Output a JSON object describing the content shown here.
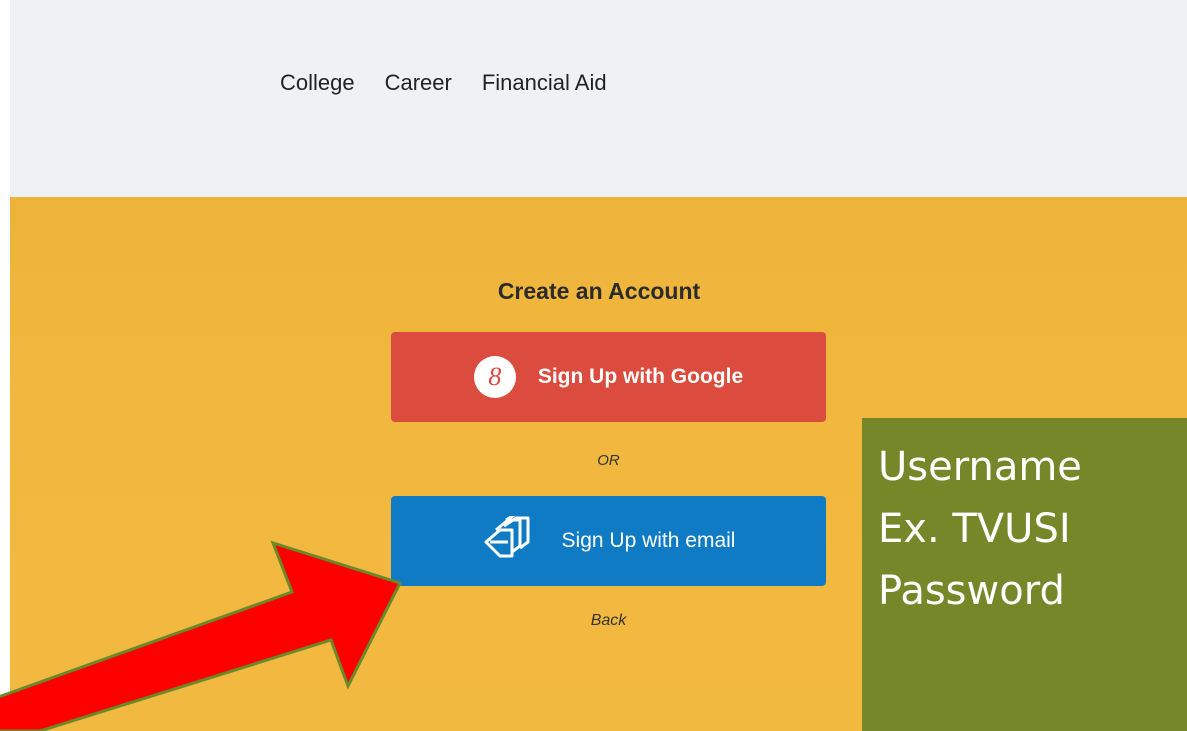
{
  "nav": {
    "items": [
      {
        "label": "College"
      },
      {
        "label": "Career"
      },
      {
        "label": "Financial Aid"
      }
    ]
  },
  "signup": {
    "title": "Create an Account",
    "google_button_label": "Sign Up with Google",
    "google_icon_glyph": "8",
    "or_label": "OR",
    "email_button_label": "Sign Up with email",
    "back_label": "Back"
  },
  "overlay_note": {
    "line1": "Username",
    "line2": "Ex. TVUSI",
    "line3": "Password"
  },
  "colors": {
    "nav_bg": "#eff2f5",
    "hero_bg": "#f1b73e",
    "google_red": "#dc4c3e",
    "email_blue": "#0e7bc4",
    "note_green": "#76872a",
    "arrow_red": "#ff0000"
  },
  "icons": [
    "google-icon",
    "email-stack-icon",
    "red-arrow-icon"
  ]
}
